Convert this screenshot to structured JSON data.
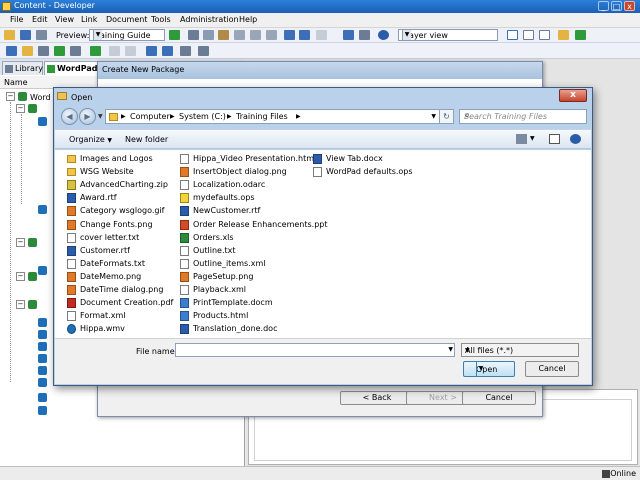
{
  "app": {
    "title": "Content - Developer",
    "menu": [
      "File",
      "Edit",
      "View",
      "Link",
      "Document",
      "Tools",
      "Administration",
      "Help"
    ],
    "toolbar": {
      "preview_label": "Preview:",
      "preview_value": "Training Guide",
      "player_value": "Player view"
    },
    "left_tabs": [
      "Library",
      "WordPad"
    ],
    "name_column": "Name",
    "tree_labels": [
      "Word"
    ],
    "status": "Online"
  },
  "package_dialog": {
    "title": "Create New Package",
    "back": "< Back",
    "next": "Next >",
    "cancel": "Cancel"
  },
  "open_dialog": {
    "title": "Open",
    "path": [
      "Computer",
      "System (C:)",
      "Training Files"
    ],
    "search_placeholder": "Search Training Files",
    "organize": "Organize",
    "new_folder": "New folder",
    "file_name_label": "File name:",
    "file_name_value": "",
    "file_type": "All files (*.*)",
    "open_button": "Open",
    "cancel_button": "Cancel",
    "files": [
      {
        "name": "Images and Logos",
        "type": "folder"
      },
      {
        "name": "WSG Website",
        "type": "folder"
      },
      {
        "name": "AdvancedCharting.zip",
        "type": "zip"
      },
      {
        "name": "Award.rtf",
        "type": "word"
      },
      {
        "name": "Category wsglogo.gif",
        "type": "img"
      },
      {
        "name": "Change Fonts.png",
        "type": "img"
      },
      {
        "name": "cover letter.txt",
        "type": "doc"
      },
      {
        "name": "Customer.rtf",
        "type": "word"
      },
      {
        "name": "DateFormats.txt",
        "type": "doc"
      },
      {
        "name": "DateMemo.png",
        "type": "img"
      },
      {
        "name": "DateTime dialog.png",
        "type": "img"
      },
      {
        "name": "Document Creation.pdf",
        "type": "pdf"
      },
      {
        "name": "Format.xml",
        "type": "doc"
      },
      {
        "name": "Hippa.wmv",
        "type": "media"
      },
      {
        "name": "Hippa_Video Presentation.html",
        "type": "doc"
      },
      {
        "name": "InsertObject dialog.png",
        "type": "img"
      },
      {
        "name": "Localization.odarc",
        "type": "doc"
      },
      {
        "name": "mydefaults.ops",
        "type": "ops"
      },
      {
        "name": "NewCustomer.rtf",
        "type": "word"
      },
      {
        "name": "Order Release Enhancements.ppt",
        "type": "ppt"
      },
      {
        "name": "Orders.xls",
        "type": "xls"
      },
      {
        "name": "Outline.txt",
        "type": "doc"
      },
      {
        "name": "Outline_items.xml",
        "type": "doc"
      },
      {
        "name": "PageSetup.png",
        "type": "img"
      },
      {
        "name": "Playback.xml",
        "type": "doc"
      },
      {
        "name": "PrintTemplate.docm",
        "type": "web"
      },
      {
        "name": "Products.html",
        "type": "web"
      },
      {
        "name": "Translation_done.doc",
        "type": "word"
      },
      {
        "name": "View Tab.docx",
        "type": "word"
      },
      {
        "name": "WordPad defaults.ops",
        "type": "doc"
      }
    ]
  }
}
